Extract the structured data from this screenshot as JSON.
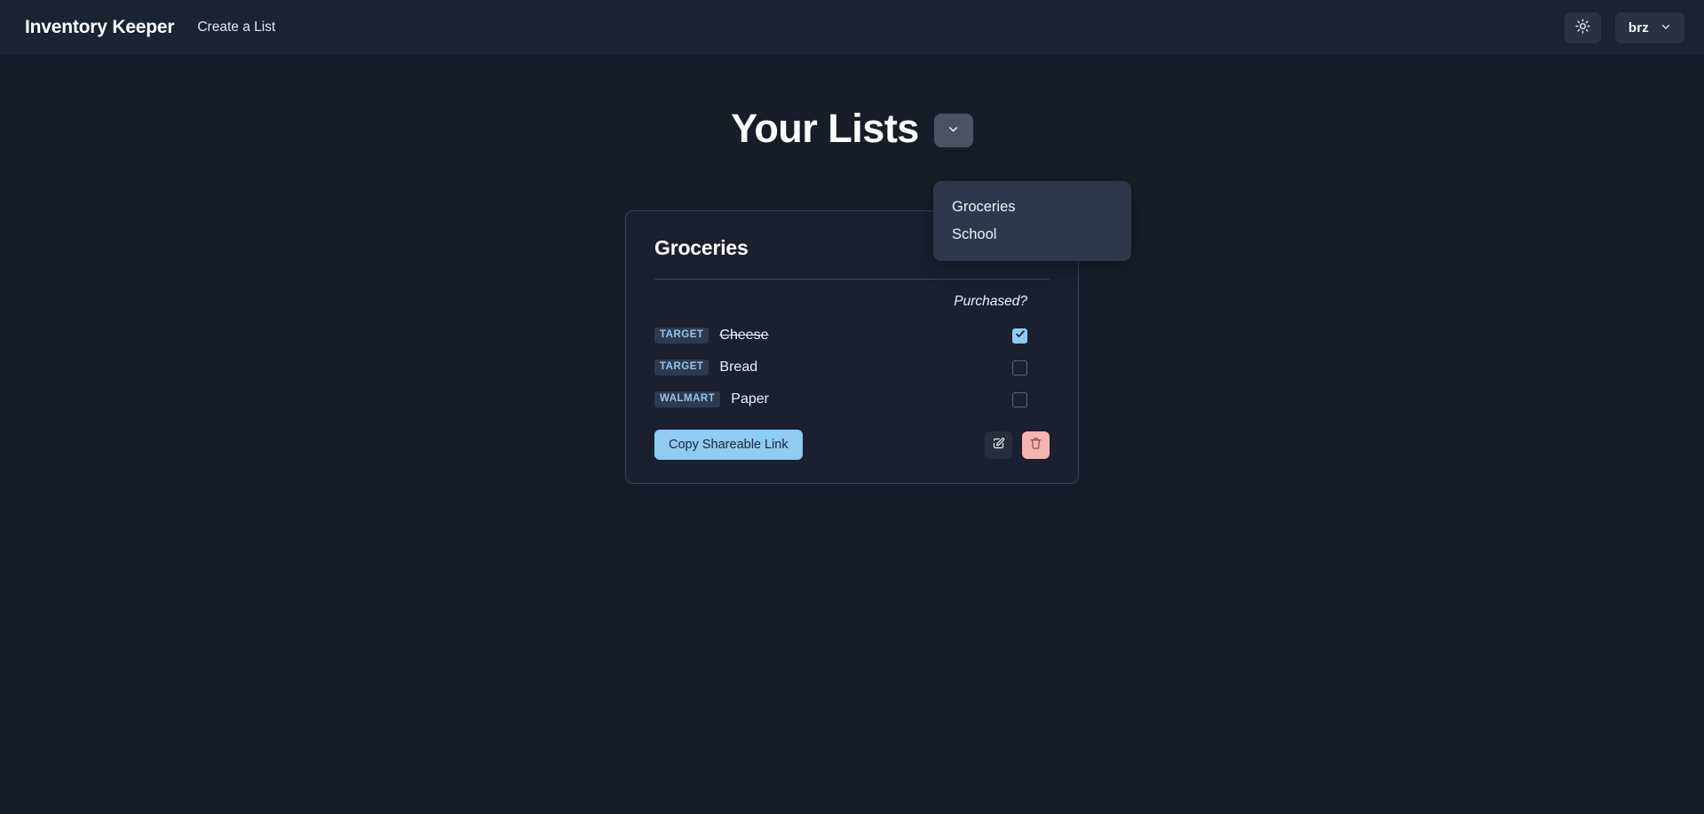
{
  "navbar": {
    "brand": "Inventory Keeper",
    "create_list_label": "Create a List",
    "theme_toggle_icon": "sun-icon",
    "user_name": "brz",
    "user_chevron_icon": "chevron-down-icon"
  },
  "page": {
    "title": "Your Lists",
    "lists_toggle_icon": "chevron-down-icon"
  },
  "lists_dropdown": {
    "open": true,
    "items": [
      {
        "label": "Groceries"
      },
      {
        "label": "School"
      }
    ]
  },
  "card": {
    "title": "Groceries",
    "purchased_column_label": "Purchased?",
    "items": [
      {
        "store": "TARGET",
        "name": "Cheese",
        "purchased": true
      },
      {
        "store": "TARGET",
        "name": "Bread",
        "purchased": false
      },
      {
        "store": "WALMART",
        "name": "Paper",
        "purchased": false
      }
    ],
    "share_button_label": "Copy Shareable Link",
    "edit_icon": "pencil-square-icon",
    "delete_icon": "trash-icon"
  },
  "colors": {
    "page_background": "#171d28",
    "navbar_background": "#1b2230",
    "accent_blue": "#8fcbf2",
    "danger_pink": "#f6b3af",
    "badge_background": "#2c3a4d",
    "dropdown_background": "#2e384a",
    "card_border": "#3b4453"
  }
}
